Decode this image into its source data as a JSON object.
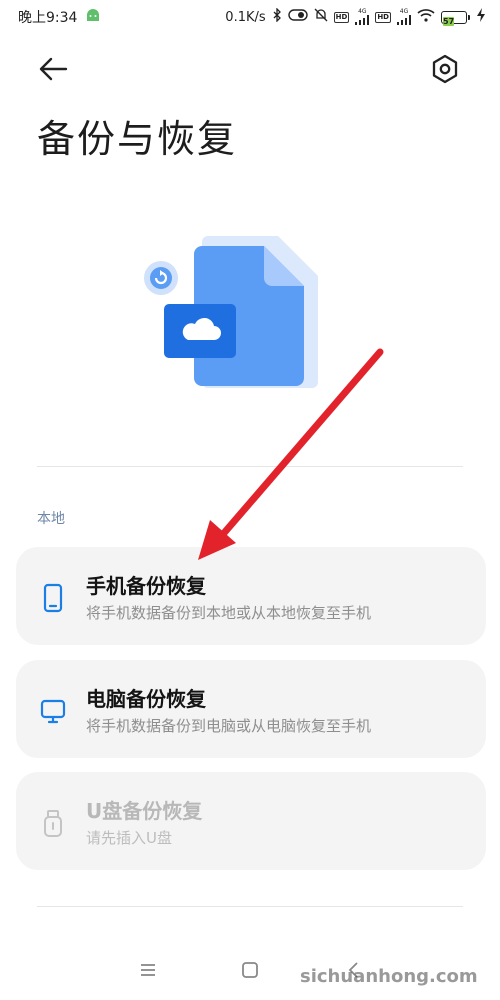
{
  "status_bar": {
    "time": "晚上9:34",
    "net_speed": "0.1K/s",
    "badge_hd": "HD",
    "signal_tag": "4G",
    "battery": "57"
  },
  "header": {
    "title": "备份与恢复"
  },
  "sections": {
    "local_label": "本地"
  },
  "cards": [
    {
      "title": "手机备份恢复",
      "subtitle": "将手机数据备份到本地或从本地恢复至手机",
      "enabled": true,
      "icon": "phone-icon"
    },
    {
      "title": "电脑备份恢复",
      "subtitle": "将手机数据备份到电脑或从电脑恢复至手机",
      "enabled": true,
      "icon": "monitor-icon"
    },
    {
      "title": "U盘备份恢复",
      "subtitle": "请先插入U盘",
      "enabled": false,
      "icon": "usb-drive-icon"
    }
  ],
  "watermark": "sichuanhong.com",
  "colors": {
    "accent": "#1a73e8",
    "arrow": "#e3232b",
    "card_bg": "#f4f4f4",
    "section_label": "#6f86a6"
  }
}
